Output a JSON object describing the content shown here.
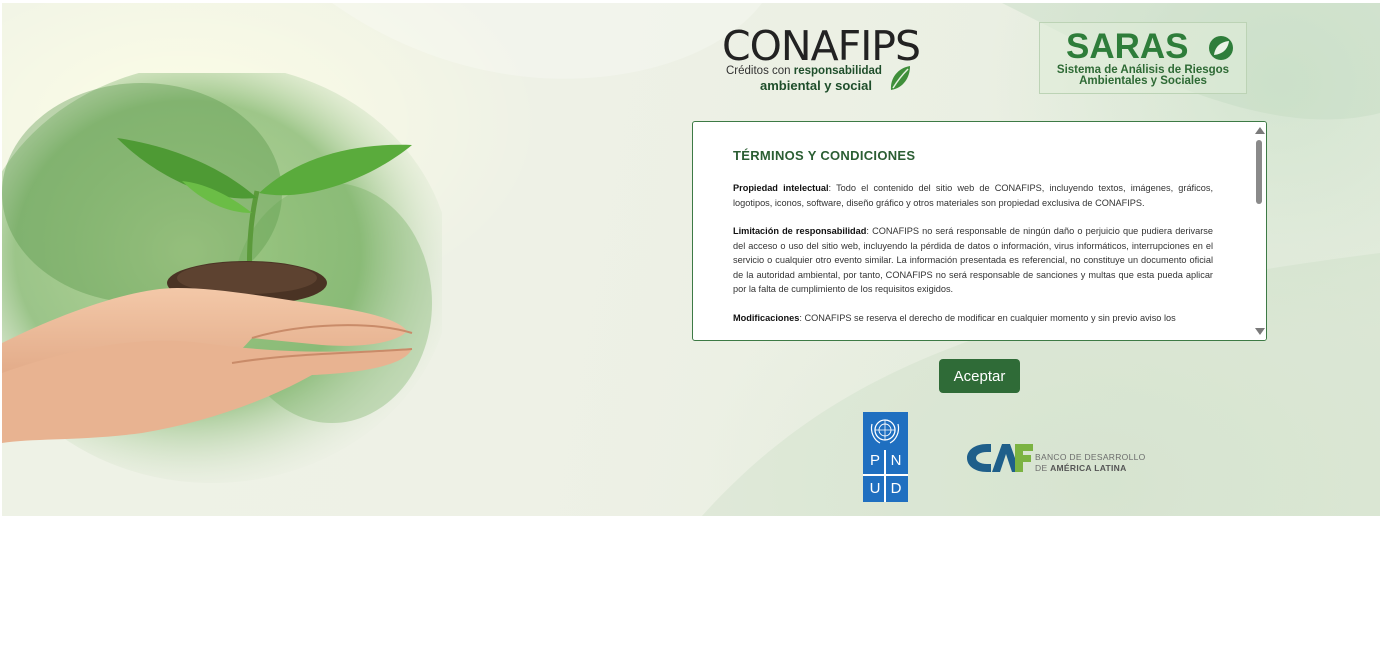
{
  "brand": {
    "conafips_name": "CONAFIPS",
    "conafips_tagline_prefix": "Créditos con",
    "conafips_tagline_bold": "responsabilidad",
    "conafips_tagline_line2": "ambiental y social",
    "saras_name": "SARAS",
    "saras_line1": "Sistema de Análisis de Riesgos",
    "saras_line2": "Ambientales y Sociales"
  },
  "terms": {
    "title": "TÉRMINOS Y CONDICIONES",
    "sections": [
      {
        "label": "Propiedad intelectual",
        "text": ": Todo el contenido del sitio web de CONAFIPS, incluyendo textos, imágenes, gráficos, logotipos, iconos, software, diseño gráfico y otros materiales son propiedad exclusiva de CONAFIPS."
      },
      {
        "label": "Limitación de responsabilidad",
        "text": ": CONAFIPS no será responsable de ningún daño o perjuicio que pudiera derivarse del acceso o uso del sitio web, incluyendo la pérdida de datos o información, virus informáticos, interrupciones en el servicio o cualquier otro evento similar. La información presentada es referencial, no constituye un documento oficial de la autoridad ambiental, por tanto, CONAFIPS no será responsable de sanciones y multas que esta pueda aplicar por la falta de cumplimiento de los requisitos exigidos."
      },
      {
        "label": "Modificaciones",
        "text": ": CONAFIPS se reserva el derecho de modificar en cualquier momento y sin previo aviso los"
      }
    ]
  },
  "actions": {
    "accept_label": "Aceptar"
  },
  "partners": {
    "pnud_letters": [
      "P",
      "N",
      "U",
      "D"
    ],
    "caf_line1": "BANCO DE DESARROLLO",
    "caf_line2_prefix": "DE",
    "caf_line2_bold": "AMÉRICA LATINA"
  },
  "colors": {
    "brand_green": "#2f6b37",
    "saras_green": "#2e7d3a",
    "pnud_blue": "#1f6fc0",
    "caf_blue": "#1f5f8a",
    "caf_green": "#7bb342"
  }
}
